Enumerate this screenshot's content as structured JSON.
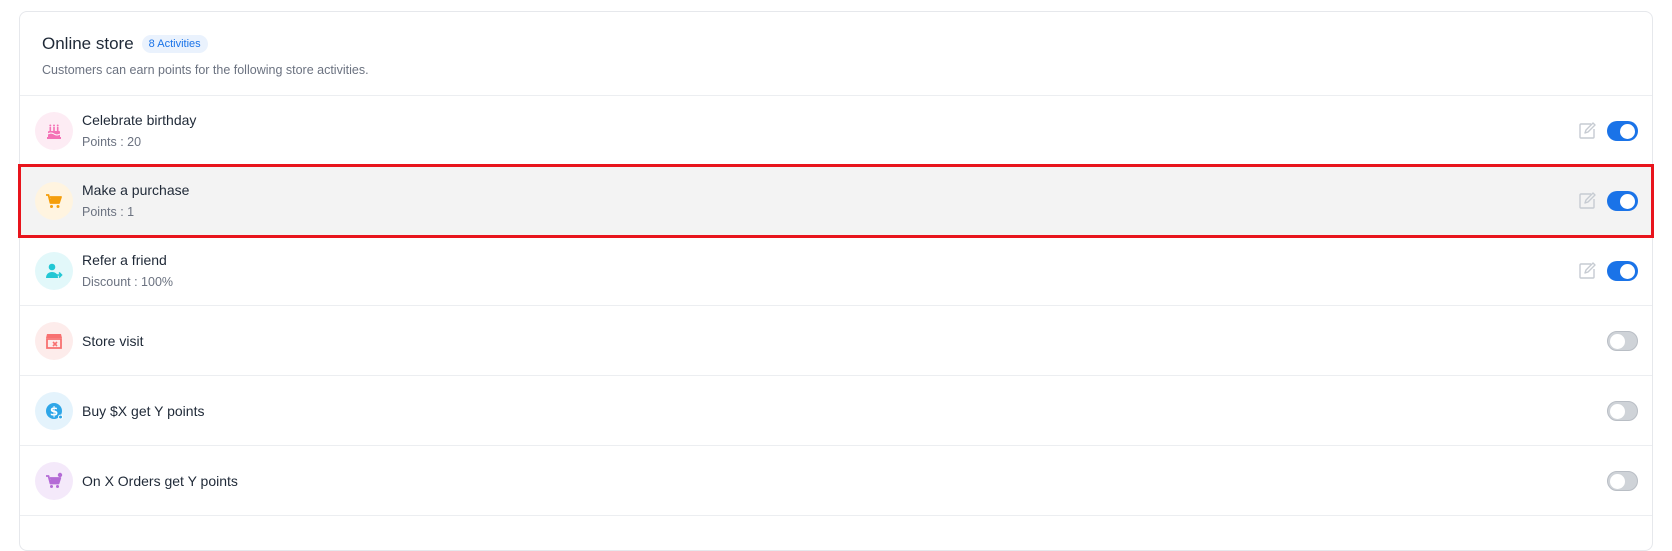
{
  "header": {
    "title": "Online store",
    "badge": "8 Activities",
    "subtitle": "Customers can earn points for the following store activities."
  },
  "activities": [
    {
      "name": "Celebrate birthday",
      "meta": "Points : 20",
      "icon": "birthday-cake-icon",
      "icon_color": "#f472b6",
      "icon_bg": "#fdecf4",
      "enabled": true,
      "editable": true
    },
    {
      "name": "Make a purchase",
      "meta": "Points : 1",
      "icon": "shopping-cart-icon",
      "icon_color": "#f59e0b",
      "icon_bg": "#fff4e0",
      "enabled": true,
      "editable": true,
      "highlighted": true
    },
    {
      "name": "Refer a friend",
      "meta": "Discount : 100%",
      "icon": "refer-friend-icon",
      "icon_color": "#22c7d4",
      "icon_bg": "#e2f8fa",
      "enabled": true,
      "editable": true
    },
    {
      "name": "Store visit",
      "meta": "",
      "icon": "store-icon",
      "icon_color": "#f87171",
      "icon_bg": "#fdeceb",
      "enabled": false,
      "editable": false
    },
    {
      "name": "Buy $X get Y points",
      "meta": "",
      "icon": "dollar-coin-icon",
      "icon_color": "#2ea6e8",
      "icon_bg": "#e4f3fc",
      "enabled": false,
      "editable": false
    },
    {
      "name": "On X Orders get Y points",
      "meta": "",
      "icon": "cart-add-icon",
      "icon_color": "#b46bd6",
      "icon_bg": "#f4e9fa",
      "enabled": false,
      "editable": false
    }
  ],
  "colors": {
    "accent": "#1a73e8",
    "highlight_border": "#e8141c"
  }
}
